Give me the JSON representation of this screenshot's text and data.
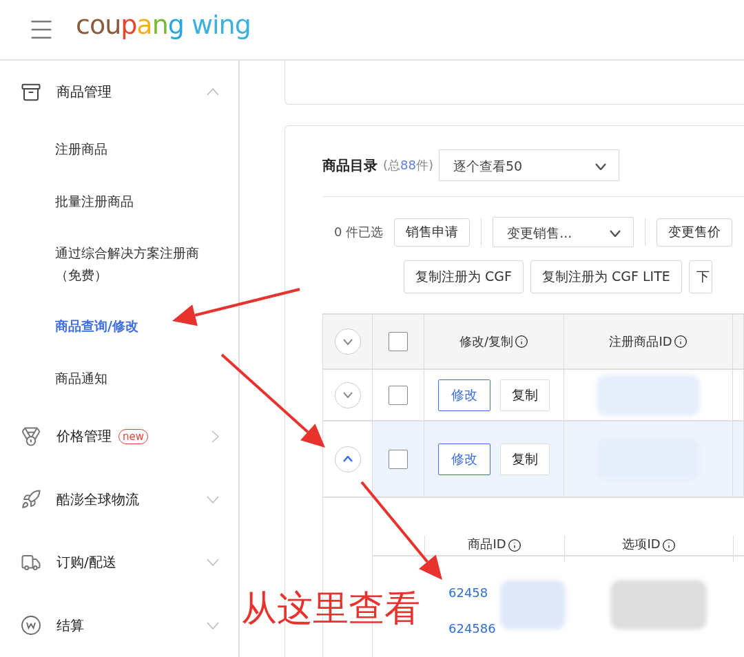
{
  "header": {
    "logo": [
      {
        "text": "cou",
        "color": "#8a5a3b"
      },
      {
        "text": "p",
        "color": "#e8452c"
      },
      {
        "text": "a",
        "color": "#f2b01e"
      },
      {
        "text": "n",
        "color": "#78b833"
      },
      {
        "text": "g",
        "color": "#2aa6de"
      },
      {
        "text": " wing",
        "color": "#3bb1df"
      }
    ]
  },
  "sidebar": {
    "sections": [
      {
        "kind": "group",
        "label": "商品管理",
        "expanded": true,
        "children": [
          {
            "label": "注册商品",
            "selected": false
          },
          {
            "label": "批量注册商品",
            "selected": false
          },
          {
            "label": "通过综合解决方案注册商",
            "note": "（免费）",
            "selected": false
          },
          {
            "label": "商品查询/修改",
            "selected": true
          },
          {
            "label": "商品通知",
            "selected": false
          }
        ]
      },
      {
        "kind": "link",
        "label": "价格管理",
        "badge": "new"
      },
      {
        "kind": "group",
        "label": "酷澎全球物流",
        "expanded": false
      },
      {
        "kind": "group",
        "label": "订购/配送",
        "expanded": false
      },
      {
        "kind": "group",
        "label": "结算",
        "expanded": false
      }
    ]
  },
  "catalog": {
    "title": "商品目录",
    "count_prefix": "(总",
    "count": "88",
    "count_suffix": "件)",
    "view_select": "逐个查看50"
  },
  "selection": {
    "count_label": "0 件已选",
    "actions": [
      {
        "kind": "button",
        "label": "销售申请"
      },
      {
        "kind": "select",
        "label": "变更销售..."
      },
      {
        "kind": "button",
        "label": "变更售价"
      }
    ],
    "copy_actions": [
      {
        "label": "复制注册为 CGF"
      },
      {
        "label": "复制注册为 CGF LITE"
      },
      {
        "label": "下"
      }
    ]
  },
  "table": {
    "header_checked": false,
    "columns": [
      {
        "label": "修改/复制",
        "info": true
      },
      {
        "label": "注册商品ID",
        "info": true
      }
    ],
    "rows": [
      {
        "expanded": false,
        "checked": false,
        "selected": false,
        "edit": "修改",
        "copy": "复制"
      },
      {
        "expanded": true,
        "checked": false,
        "selected": true,
        "edit": "修改",
        "copy": "复制"
      }
    ],
    "detail": {
      "columns": [
        {
          "label": "商品ID",
          "info": true
        },
        {
          "label": "选项ID",
          "info": true
        }
      ],
      "rows": [
        {
          "product_id": "62458"
        },
        {
          "product_id": "624586"
        }
      ]
    }
  },
  "annotation": {
    "text": "从这里查看"
  }
}
